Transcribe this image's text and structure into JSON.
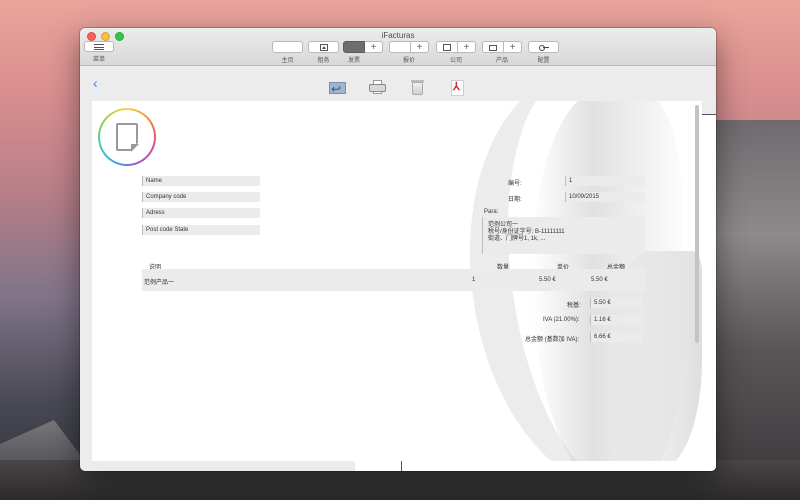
{
  "window": {
    "title": "iFacturas"
  },
  "toolbar": {
    "menu_label": "菜单",
    "groups": [
      {
        "label": "主页"
      },
      {
        "label": "租务"
      },
      {
        "label": "发票"
      },
      {
        "label": "报价"
      },
      {
        "label": "公司"
      },
      {
        "label": "产品"
      },
      {
        "label": "配置"
      }
    ],
    "plus": "+"
  },
  "subbar": {
    "back_glyph": "‹"
  },
  "invoice": {
    "client": {
      "name_placeholder": "Name",
      "company_placeholder": "Company code",
      "address_placeholder": "Adress",
      "postcode_placeholder": "Post code State"
    },
    "number_label": "编号:",
    "number_value": "1",
    "date_label": "日期:",
    "date_value": "10/09/2015",
    "to_label": "Para:",
    "to_lines": [
      "范例公司一",
      "税号/身份证字号: B-11111111",
      "街道、门牌号1, 1k, ..."
    ],
    "columns": {
      "description": "说明",
      "quantity": "数量",
      "unit_price": "单价",
      "total": "总金额"
    },
    "items": [
      {
        "description": "范例产品一",
        "quantity": "1",
        "unit_price": "5.50 €",
        "total": "5.50 €"
      }
    ],
    "totals": {
      "base_label": "税基:",
      "base_value": "5.50 €",
      "iva_label": "IVA (21.00%):",
      "iva_value": "1.16 €",
      "grand_label": "总金额 (基数加 IVA):",
      "grand_value": "6.66 €"
    }
  },
  "colors": {
    "accent": "#2a8ff1",
    "active_tab": "#6d6d6d"
  }
}
